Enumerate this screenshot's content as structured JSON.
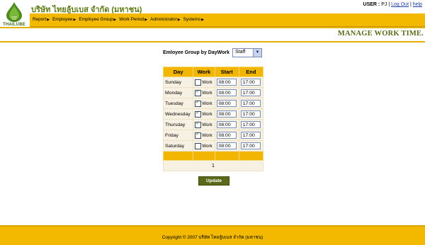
{
  "header": {
    "logo_text": "THAILUBE",
    "company_name": "บริษัท ไทยลู้บเบส จำกัด (มหาชน)",
    "user_label": "USER :",
    "user_name": "PJ",
    "logout_label": "Log Out",
    "help_label": "help"
  },
  "menu": {
    "items": [
      "Report",
      "Employee",
      "Employee Group",
      "Work Period",
      "Administrator",
      "Systems"
    ]
  },
  "page": {
    "title": "MANAGE WORK TIME."
  },
  "filter": {
    "label": "Emloyee Group by DayWork",
    "selected": "Staff"
  },
  "table": {
    "headers": [
      "Day",
      "Work",
      "Start",
      "End"
    ],
    "work_label": "Work",
    "rows": [
      {
        "day": "Sunday",
        "work": false,
        "start": "08:00",
        "end": "17:00"
      },
      {
        "day": "Monday",
        "work": true,
        "start": "08:00",
        "end": "17:00"
      },
      {
        "day": "Tuesday",
        "work": true,
        "start": "08:00",
        "end": "17:00"
      },
      {
        "day": "Wednesday",
        "work": true,
        "start": "08:00",
        "end": "17:00"
      },
      {
        "day": "Thursday",
        "work": true,
        "start": "08:00",
        "end": "17:00"
      },
      {
        "day": "Friday",
        "work": true,
        "start": "08:00",
        "end": "17:00"
      },
      {
        "day": "Saturday",
        "work": false,
        "start": "08:00",
        "end": "17:00"
      }
    ],
    "page_number": "1"
  },
  "actions": {
    "update_label": "Update"
  },
  "footer": {
    "text": "Copyright © 2007 บริษัท ไทยลู้บเบส จำกัด (มหาชน)"
  },
  "colors": {
    "accent": "#f2b900",
    "brand_green": "#5a7a10",
    "cell_bg": "#f7f1e3"
  }
}
